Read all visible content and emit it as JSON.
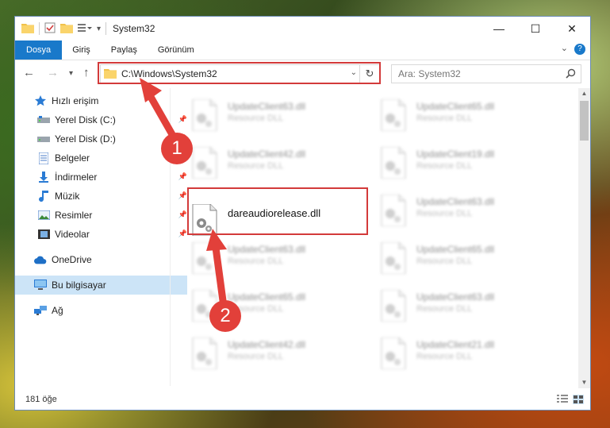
{
  "window": {
    "title": "System32",
    "controls": {
      "minimize": "—",
      "maximize": "☐",
      "close": "✕"
    }
  },
  "ribbon": {
    "tabs": [
      "Dosya",
      "Giriş",
      "Paylaş",
      "Görünüm"
    ],
    "help": "?"
  },
  "address": {
    "path": "C:\\Windows\\System32",
    "search_placeholder": "Ara: System32"
  },
  "nav": {
    "items": [
      {
        "label": "Hızlı erişim",
        "icon": "star-icon"
      },
      {
        "label": "Yerel Disk (C:)",
        "icon": "drive-icon"
      },
      {
        "label": "Yerel Disk (D:)",
        "icon": "drive-icon"
      },
      {
        "label": "Belgeler",
        "icon": "documents-icon"
      },
      {
        "label": "İndirmeler",
        "icon": "download-icon"
      },
      {
        "label": "Müzik",
        "icon": "music-icon"
      },
      {
        "label": "Resimler",
        "icon": "pictures-icon"
      },
      {
        "label": "Videolar",
        "icon": "videos-icon"
      },
      {
        "label": "OneDrive",
        "icon": "cloud-icon"
      },
      {
        "label": "Bu bilgisayar",
        "icon": "computer-icon"
      },
      {
        "label": "Ağ",
        "icon": "network-icon"
      }
    ]
  },
  "files": {
    "items": [
      {
        "name": "UpdateClient63.dll",
        "type": "Resource DLL"
      },
      {
        "name": "UpdateClient65.dll",
        "type": "Resource DLL"
      },
      {
        "name": "UpdateClient42.dll",
        "type": "Resource DLL"
      },
      {
        "name": "UpdateClient19.dll",
        "type": "Resource DLL"
      },
      {
        "name": "dareaudiorelease.dll",
        "type": ""
      },
      {
        "name": "UpdateClient63.dll",
        "type": "Resource DLL"
      },
      {
        "name": "UpdateClient63.dll",
        "type": "Resource DLL"
      },
      {
        "name": "UpdateClient65.dll",
        "type": "Resource DLL"
      },
      {
        "name": "UpdateClient65.dll",
        "type": "Resource DLL"
      },
      {
        "name": "UpdateClient63.dll",
        "type": "Resource DLL"
      },
      {
        "name": "UpdateClient42.dll",
        "type": "Resource DLL"
      },
      {
        "name": "UpdateClient21.dll",
        "type": "Resource DLL"
      }
    ]
  },
  "status": {
    "count": "181 öğe"
  },
  "annotations": {
    "step1": "1",
    "step2": "2"
  },
  "colors": {
    "accent": "#1979ca",
    "highlight": "#d33a3a",
    "badge": "#e2403a",
    "selected": "#cce4f7"
  }
}
